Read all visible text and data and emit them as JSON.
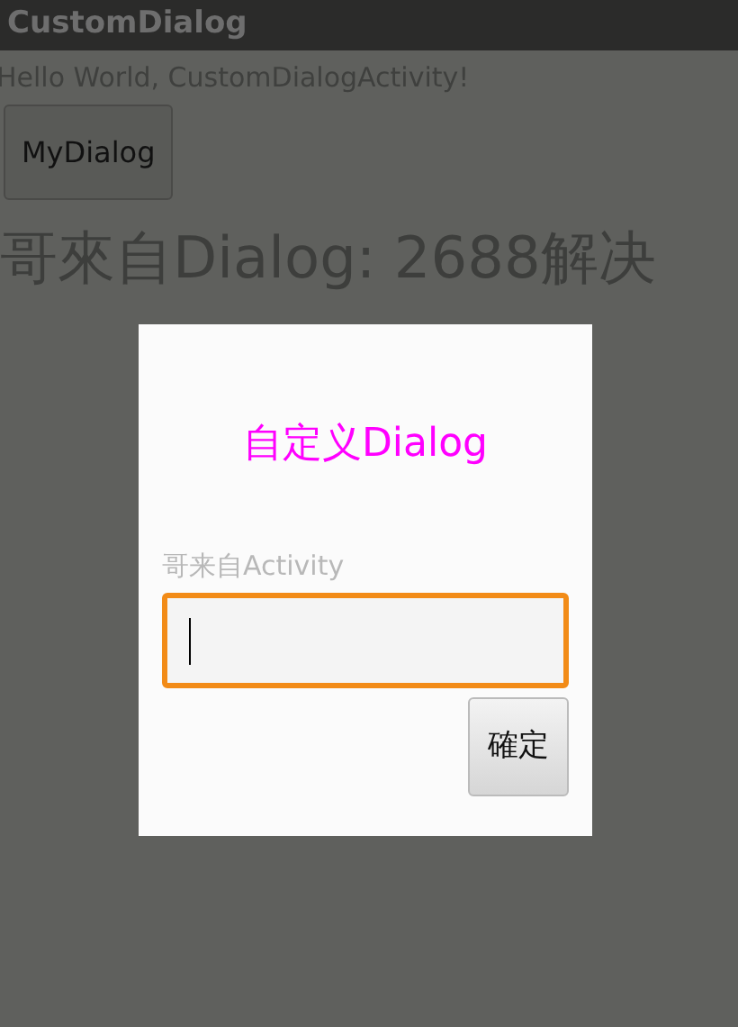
{
  "window": {
    "title": "CustomDialog"
  },
  "content": {
    "greeting": "Hello World, CustomDialogActivity!",
    "button": "MyDialog",
    "result": "哥來自Dialog: 2688解决"
  },
  "dialog": {
    "title": "自定义Dialog",
    "label": "哥来自Activity",
    "field": {
      "focused": true
    },
    "button": "確定"
  }
}
